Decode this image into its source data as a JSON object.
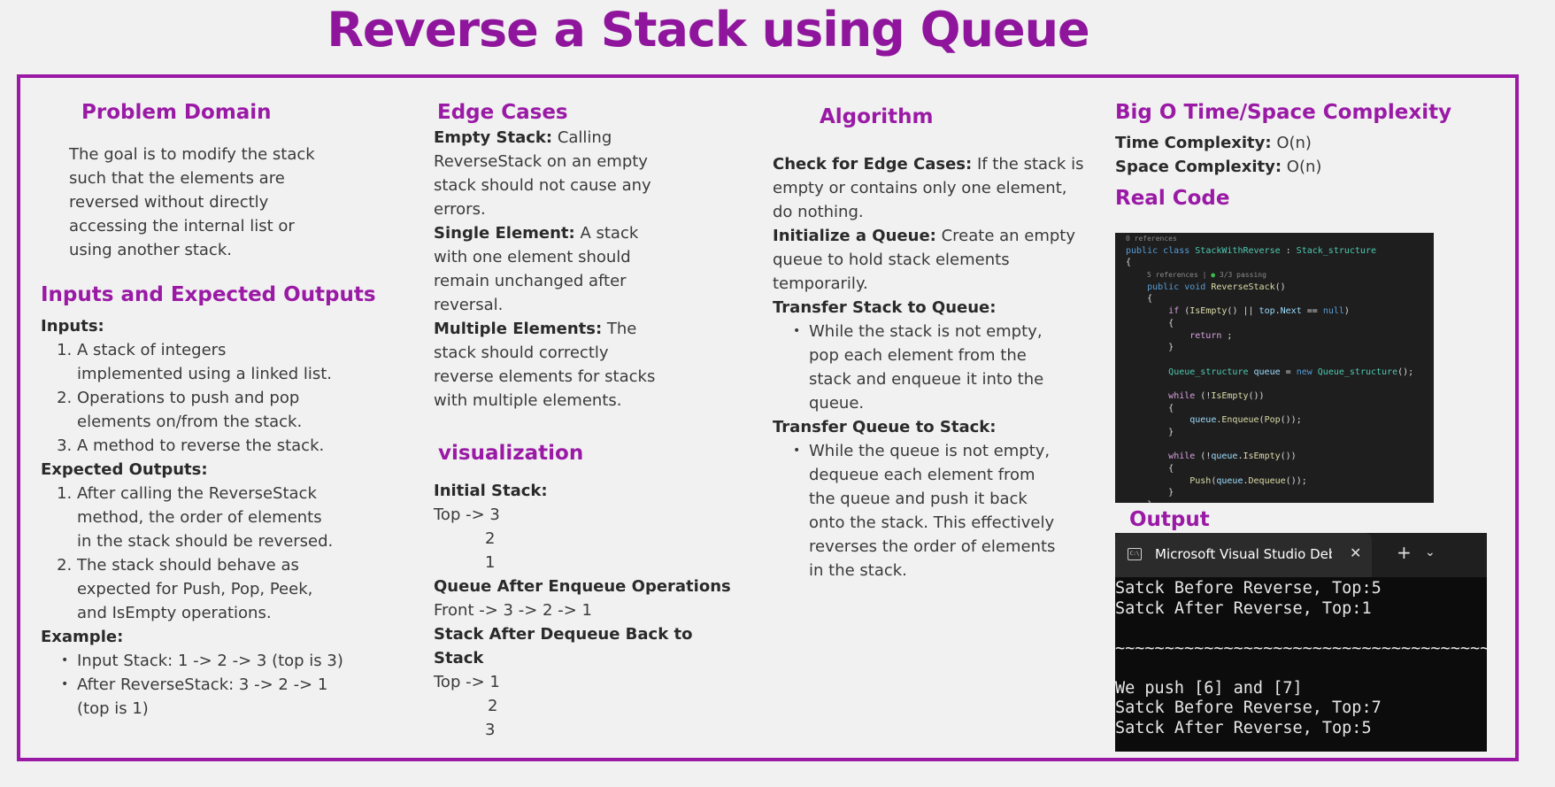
{
  "title": "Reverse a Stack using Queue",
  "problem_domain": {
    "heading": "Problem Domain",
    "lines": [
      "The goal is to modify the stack",
      "such that the elements are",
      "reversed without directly",
      "accessing the internal list or",
      "using another stack."
    ]
  },
  "inputs_outputs": {
    "heading": "Inputs and Expected Outputs",
    "inputs_label": "Inputs:",
    "inputs": [
      [
        "A stack of integers",
        "implemented using a linked list."
      ],
      [
        "Operations to push and pop",
        "elements on/from the stack."
      ],
      [
        "A method to reverse the stack."
      ]
    ],
    "outputs_label": "Expected Outputs:",
    "outputs": [
      [
        "After calling the ReverseStack",
        "method, the order of elements",
        "in the stack should be reversed."
      ],
      [
        "The stack should behave as",
        "expected for Push, Pop, Peek,",
        "and IsEmpty operations."
      ]
    ],
    "example_label": "Example:",
    "examples": [
      [
        "Input Stack: 1 -> 2 -> 3 (top is 3)"
      ],
      [
        "After ReverseStack: 3 -> 2 -> 1",
        "(top is 1)"
      ]
    ]
  },
  "edge_cases": {
    "heading": "Edge Cases",
    "items": [
      {
        "label": "Empty Stack:",
        "first": " Calling",
        "rest": [
          "ReverseStack on an empty",
          "stack should not cause any",
          "errors."
        ]
      },
      {
        "label": "Single Element:",
        "first": " A stack",
        "rest": [
          "with one element should",
          "remain unchanged after",
          "reversal."
        ]
      },
      {
        "label": "Multiple Elements:",
        "first": " The",
        "rest": [
          "stack should correctly",
          "reverse elements for stacks",
          "with multiple elements."
        ]
      }
    ]
  },
  "visualization": {
    "heading": "visualization",
    "initial_label": "Initial Stack:",
    "initial": [
      "Top -> 3",
      "2",
      "1"
    ],
    "queue_label": "Queue After Enqueue Operations",
    "queue": "Front -> 3 -> 2 -> 1",
    "after_label": [
      "Stack After Dequeue Back to",
      "Stack"
    ],
    "after": [
      "Top -> 1",
      "2",
      "3"
    ]
  },
  "algorithm": {
    "heading": "Algorithm",
    "steps": [
      {
        "label": "Check for Edge Cases:",
        "first": " If the stack is",
        "rest": [
          "empty or contains only one element,",
          "do nothing."
        ],
        "bullets": []
      },
      {
        "label": "Initialize a Queue:",
        "first": " Create an empty",
        "rest": [
          "queue to hold stack elements",
          "temporarily."
        ],
        "bullets": []
      },
      {
        "label": "Transfer Stack to Queue:",
        "first": "",
        "rest": [],
        "bullets": [
          [
            "While the stack is not empty,",
            "pop each element from the",
            "stack and enqueue it into the",
            "queue."
          ]
        ]
      },
      {
        "label": "Transfer Queue to Stack:",
        "first": "",
        "rest": [],
        "bullets": [
          [
            "While the queue is not empty,",
            "dequeue each element from",
            "the queue and push it back",
            "onto the stack. This effectively",
            "reverses the order of elements",
            "in the stack."
          ]
        ]
      }
    ]
  },
  "complexity": {
    "heading": "Big O Time/Space Complexity",
    "time_label": "Time Complexity:",
    "time_value": " O(n)",
    "space_label": "Space Complexity:",
    "space_value": " O(n)"
  },
  "real_code": {
    "heading": "Real Code",
    "refs_top": "0 references",
    "refs_method": "5 references | ",
    "passing": "3/3 passing"
  },
  "output": {
    "heading": "Output",
    "tab_label": "Microsoft Visual Studio Debug Console",
    "tab_close": "✕",
    "tab_plus": "+",
    "tab_chevron": "⌄",
    "lines": [
      "Satck Before Reverse, Top:5",
      "Satck After Reverse, Top:1",
      "",
      "~~~~~~~~~~~~~~~~~~~~~~~~~~~~~~~~~~~~~~~~",
      "",
      "We push [6] and [7]",
      "Satck Before Reverse, Top:7",
      "Satck After Reverse, Top:5"
    ]
  }
}
